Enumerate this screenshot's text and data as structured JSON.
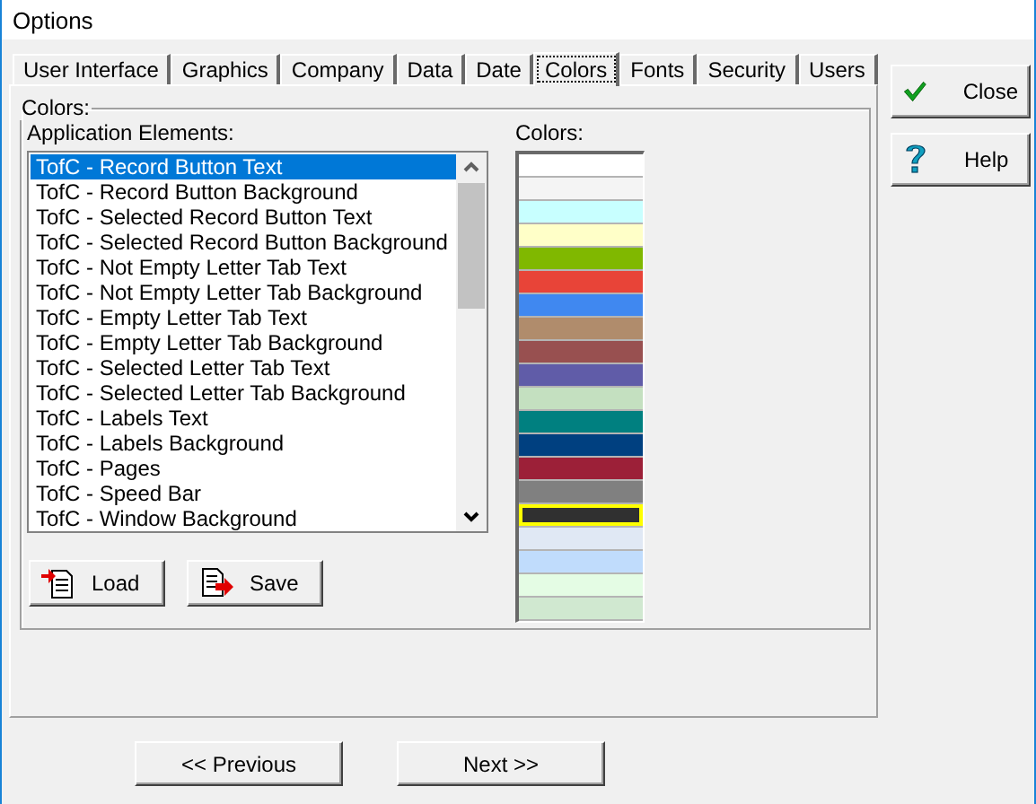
{
  "window": {
    "title": "Options"
  },
  "tabs": [
    {
      "label": "User Interface",
      "selected": false
    },
    {
      "label": "Graphics",
      "selected": false
    },
    {
      "label": "Company",
      "selected": false
    },
    {
      "label": "Data",
      "selected": false
    },
    {
      "label": "Date",
      "selected": false
    },
    {
      "label": "Colors",
      "selected": true
    },
    {
      "label": "Fonts",
      "selected": false
    },
    {
      "label": "Security",
      "selected": false
    },
    {
      "label": "Users",
      "selected": false
    }
  ],
  "group": {
    "title": "Colors:",
    "elements_label": "Application Elements:",
    "colors_label": "Colors:"
  },
  "elements": [
    {
      "label": "TofC - Record Button Text",
      "selected": true
    },
    {
      "label": "TofC - Record Button Background",
      "selected": false
    },
    {
      "label": "TofC - Selected Record Button Text",
      "selected": false
    },
    {
      "label": "TofC - Selected Record Button Background",
      "selected": false
    },
    {
      "label": "TofC - Not Empty Letter Tab Text",
      "selected": false
    },
    {
      "label": "TofC - Not Empty Letter Tab Background",
      "selected": false
    },
    {
      "label": "TofC - Empty Letter Tab Text",
      "selected": false
    },
    {
      "label": "TofC - Empty Letter Tab Background",
      "selected": false
    },
    {
      "label": "TofC - Selected Letter Tab Text",
      "selected": false
    },
    {
      "label": "TofC - Selected Letter Tab Background",
      "selected": false
    },
    {
      "label": "TofC - Labels Text",
      "selected": false
    },
    {
      "label": "TofC - Labels Background",
      "selected": false
    },
    {
      "label": "TofC - Pages",
      "selected": false
    },
    {
      "label": "TofC - Speed Bar",
      "selected": false
    },
    {
      "label": "TofC - Window Background",
      "selected": false
    }
  ],
  "swatches": [
    {
      "color": "#ffffff",
      "selected": false
    },
    {
      "color": "#f4f4f4",
      "selected": false
    },
    {
      "color": "#c8ffff",
      "selected": false
    },
    {
      "color": "#ffffc8",
      "selected": false
    },
    {
      "color": "#80b800",
      "selected": false
    },
    {
      "color": "#e84438",
      "selected": false
    },
    {
      "color": "#4088f0",
      "selected": false
    },
    {
      "color": "#b08c6c",
      "selected": false
    },
    {
      "color": "#985050",
      "selected": false
    },
    {
      "color": "#605ca8",
      "selected": false
    },
    {
      "color": "#c4e0c0",
      "selected": false
    },
    {
      "color": "#008080",
      "selected": false
    },
    {
      "color": "#004080",
      "selected": false
    },
    {
      "color": "#9c2038",
      "selected": false
    },
    {
      "color": "#808080",
      "selected": false
    },
    {
      "color": "#303030",
      "selected": true
    },
    {
      "color": "#e0e8f4",
      "selected": false
    },
    {
      "color": "#c0dcfc",
      "selected": false
    },
    {
      "color": "#e4fce4",
      "selected": false
    },
    {
      "color": "#d0e8d0",
      "selected": false
    }
  ],
  "list_buttons": [
    {
      "kind": "load",
      "label": "Load"
    },
    {
      "kind": "save",
      "label": "Save"
    }
  ],
  "side_buttons": [
    {
      "kind": "close",
      "label": "Close"
    },
    {
      "kind": "help",
      "label": "Help"
    }
  ],
  "nav_buttons": [
    "<< Previous",
    "Next >>"
  ]
}
